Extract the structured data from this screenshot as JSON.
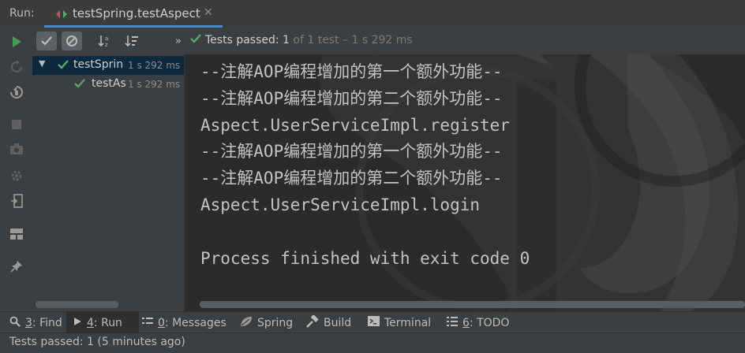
{
  "header": {
    "run_label": "Run:",
    "tab_title": "testSpring.testAspect",
    "close_glyph": "✕"
  },
  "left_toolbar": {
    "icons": [
      "run-icon",
      "rerun-failed-icon",
      "toggle-auto-test-icon",
      "stop-icon",
      "camera-icon",
      "settings-icon",
      "exit-icon",
      "layout-icon",
      "pin-icon"
    ]
  },
  "test_toolbar": {
    "expand_glyph": "»",
    "status_prefix": "Tests passed: 1",
    "status_rest": " of 1 test – 1 s 292 ms"
  },
  "tree": {
    "rows": [
      {
        "name": "testSprin",
        "time": "1 s 292 ms"
      },
      {
        "name": "testAs",
        "time": "1 s 292 ms"
      }
    ]
  },
  "console": {
    "lines": [
      "--注解AOP编程增加的第一个额外功能--",
      "--注解AOP编程增加的第二个额外功能--",
      "Aspect.UserServiceImpl.register",
      "--注解AOP编程增加的第一个额外功能--",
      "--注解AOP编程增加的第二个额外功能--",
      "Aspect.UserServiceImpl.login",
      "",
      "Process finished with exit code 0"
    ]
  },
  "bottom_tabs": [
    {
      "num": "3",
      "label": ": Find",
      "icon": "search-icon"
    },
    {
      "num": "4",
      "label": ": Run",
      "icon": "run-icon"
    },
    {
      "num": "0",
      "label": ": Messages",
      "icon": "messages-icon"
    },
    {
      "num": "",
      "label": "Spring",
      "icon": "spring-leaf-icon"
    },
    {
      "num": "",
      "label": "Build",
      "icon": "hammer-icon"
    },
    {
      "num": "",
      "label": "Terminal",
      "icon": "terminal-icon"
    },
    {
      "num": "6",
      "label": ": TODO",
      "icon": "todo-list-icon"
    }
  ],
  "status_bar": {
    "text": "Tests passed: 1 (5 minutes ago)"
  },
  "colors": {
    "accent": "#4a88c7",
    "pass_green": "#59a869",
    "run_green": "#499c54",
    "selected_row": "#0d293e"
  }
}
